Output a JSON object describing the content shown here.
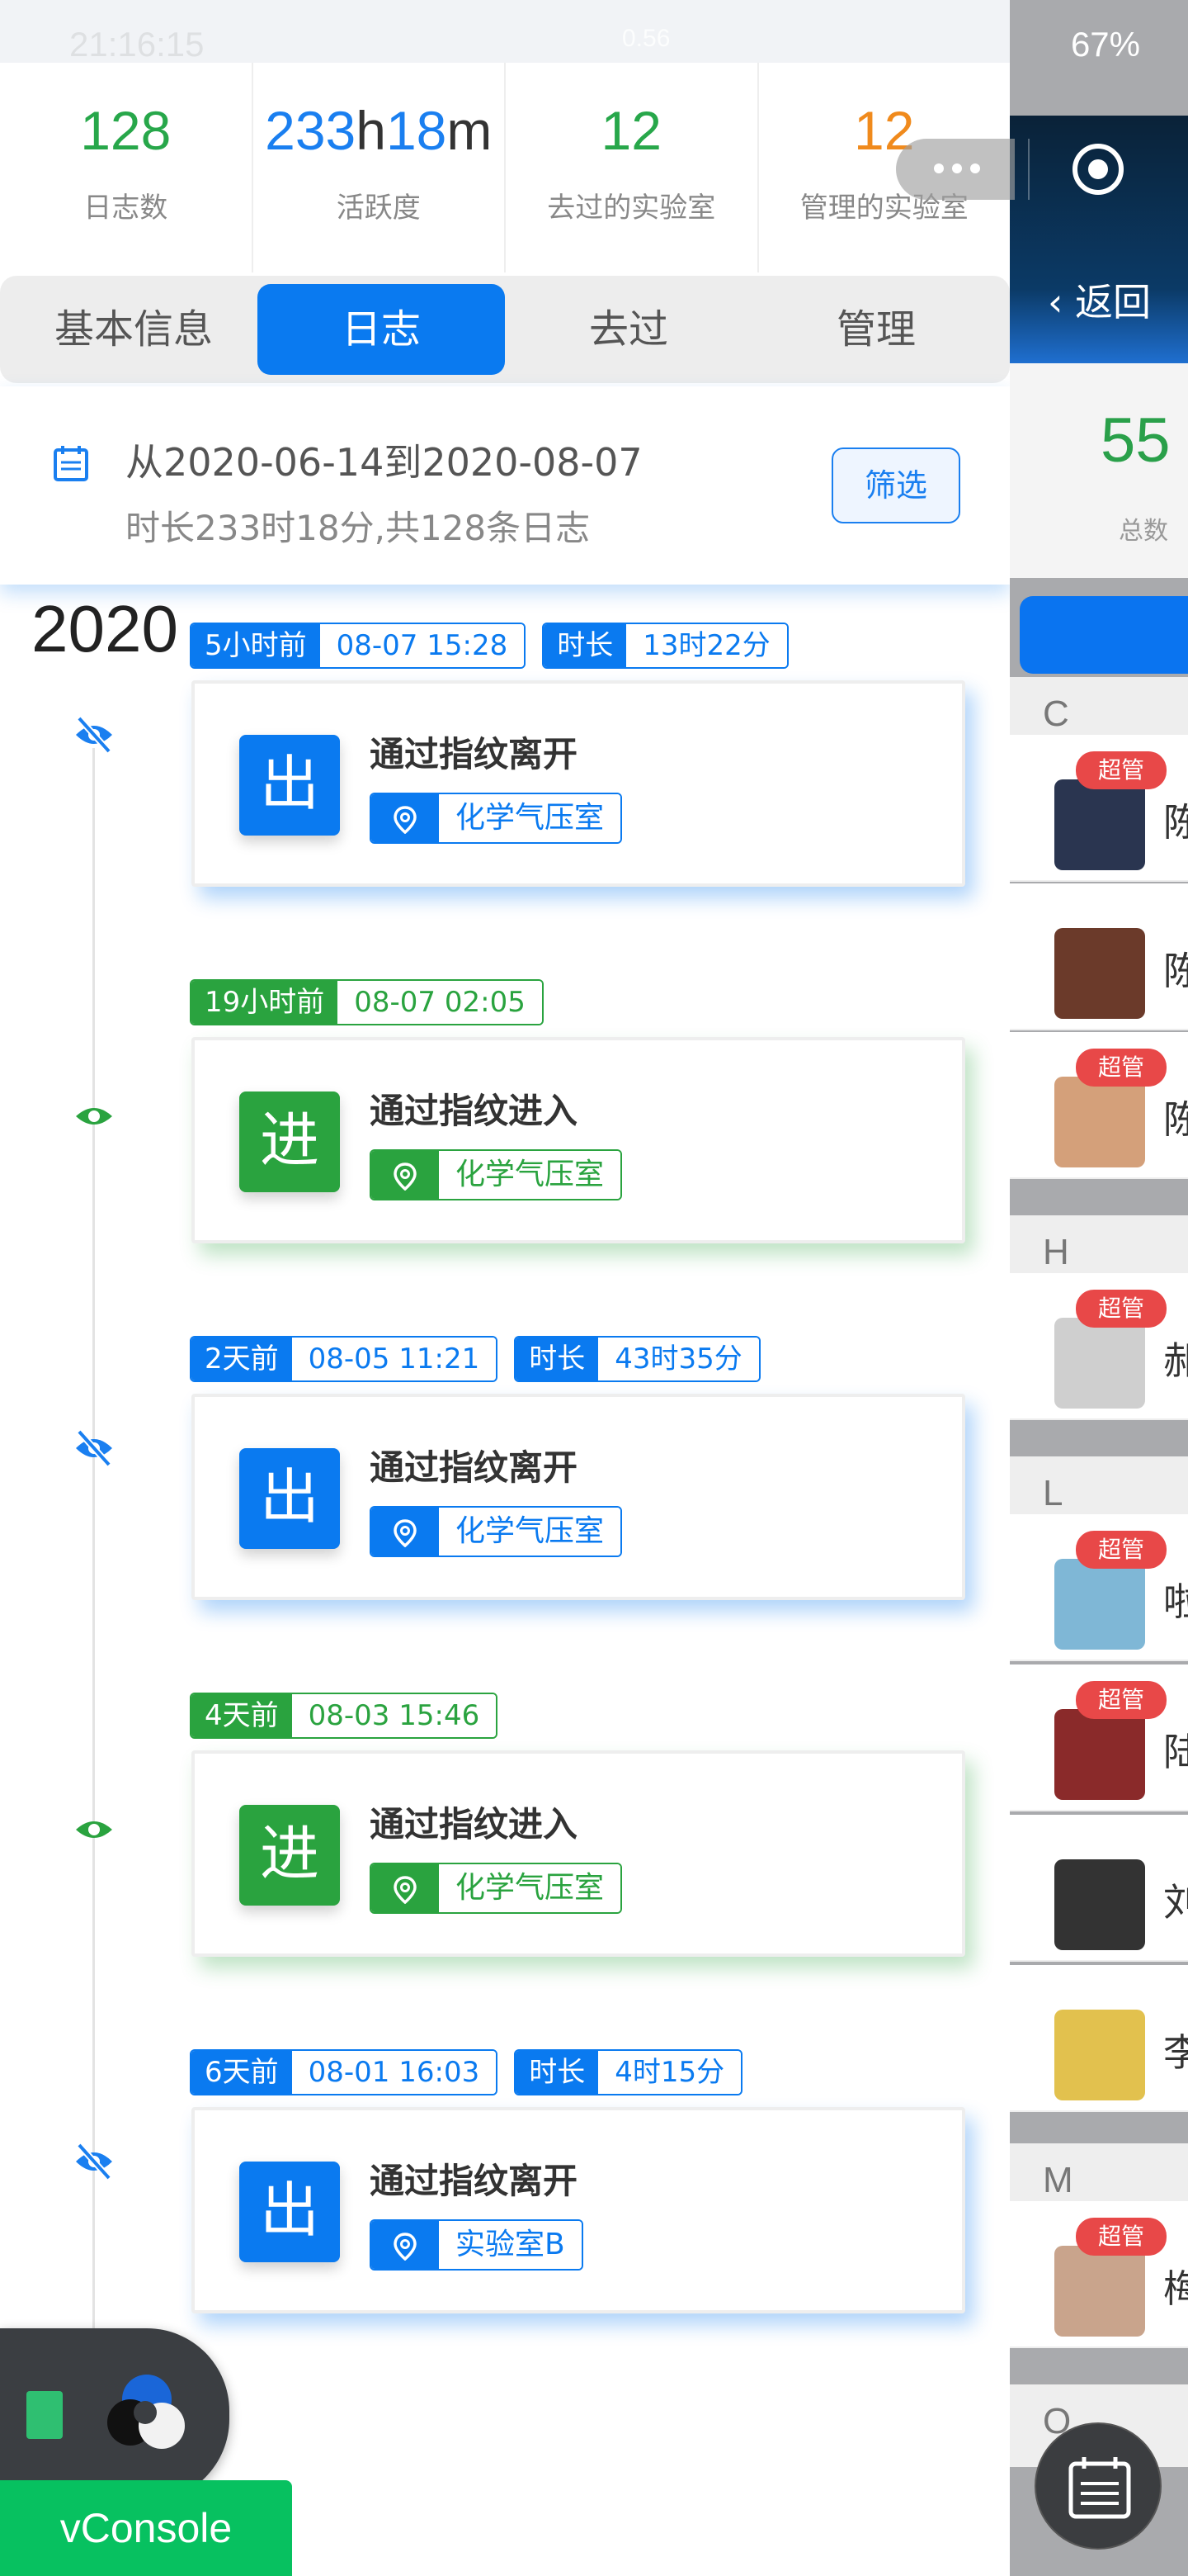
{
  "status_bar": {
    "time": "21:16:15",
    "speed": "0.56",
    "battery": "67%"
  },
  "stats": [
    {
      "value_num": "128",
      "value_unit1": "",
      "value_num2": "",
      "value_unit2": "",
      "label": "日志数",
      "color": "green"
    },
    {
      "value_num": "233",
      "value_unit1": "h",
      "value_num2": "18",
      "value_unit2": "m",
      "label": "活跃度",
      "color": "blue"
    },
    {
      "value_num": "12",
      "value_unit1": "",
      "value_num2": "",
      "value_unit2": "",
      "label": "去过的实验室",
      "color": "green"
    },
    {
      "value_num": "12",
      "value_unit1": "",
      "value_num2": "",
      "value_unit2": "",
      "label": "管理的实验室",
      "color": "orange"
    }
  ],
  "tabs": [
    {
      "label": "基本信息"
    },
    {
      "label": "日志"
    },
    {
      "label": "去过"
    },
    {
      "label": "管理"
    }
  ],
  "active_tab": "日志",
  "filter": {
    "range": "从2020-06-14到2020-08-07",
    "summary": "时长233时18分,共128条日志",
    "button": "筛选"
  },
  "year": "2020",
  "entries": [
    {
      "type": "out",
      "ago": "5小时前",
      "time": "08-07 15:28",
      "dur_label": "时长",
      "duration": "13时22分",
      "badge": "出",
      "action": "通过指纹离开",
      "location": "化学气压室"
    },
    {
      "type": "in",
      "ago": "19小时前",
      "time": "08-07 02:05",
      "dur_label": "",
      "duration": "",
      "badge": "进",
      "action": "通过指纹进入",
      "location": "化学气压室"
    },
    {
      "type": "out",
      "ago": "2天前",
      "time": "08-05 11:21",
      "dur_label": "时长",
      "duration": "43时35分",
      "badge": "出",
      "action": "通过指纹离开",
      "location": "化学气压室"
    },
    {
      "type": "in",
      "ago": "4天前",
      "time": "08-03 15:46",
      "dur_label": "",
      "duration": "",
      "badge": "进",
      "action": "通过指纹进入",
      "location": "化学气压室"
    },
    {
      "type": "out",
      "ago": "6天前",
      "time": "08-01 16:03",
      "dur_label": "时长",
      "duration": "4时15分",
      "badge": "出",
      "action": "通过指纹离开",
      "location": "实验室B"
    }
  ],
  "background_page": {
    "back_label": "返回",
    "total_value": "55",
    "total_label": "总数",
    "sections": [
      {
        "letter": "C",
        "users": [
          {
            "badge": "超管",
            "name": "陈"
          },
          {
            "badge": "",
            "name": "陈"
          },
          {
            "badge": "超管",
            "name": "陈"
          }
        ]
      },
      {
        "letter": "H",
        "users": [
          {
            "badge": "超管",
            "name": "郝"
          }
        ]
      },
      {
        "letter": "L",
        "users": [
          {
            "badge": "超管",
            "name": "啦"
          },
          {
            "badge": "超管",
            "name": "陆"
          },
          {
            "badge": "",
            "name": "刘"
          },
          {
            "badge": "",
            "name": "李"
          }
        ]
      },
      {
        "letter": "M",
        "users": [
          {
            "badge": "超管",
            "name": "梅"
          }
        ]
      },
      {
        "letter": "O",
        "users": []
      }
    ]
  },
  "vconsole_label": "vConsole",
  "colors": {
    "primary": "#0a7af0",
    "green": "#2aa33f",
    "orange": "#f08a1c",
    "vconsole": "#07c160"
  }
}
